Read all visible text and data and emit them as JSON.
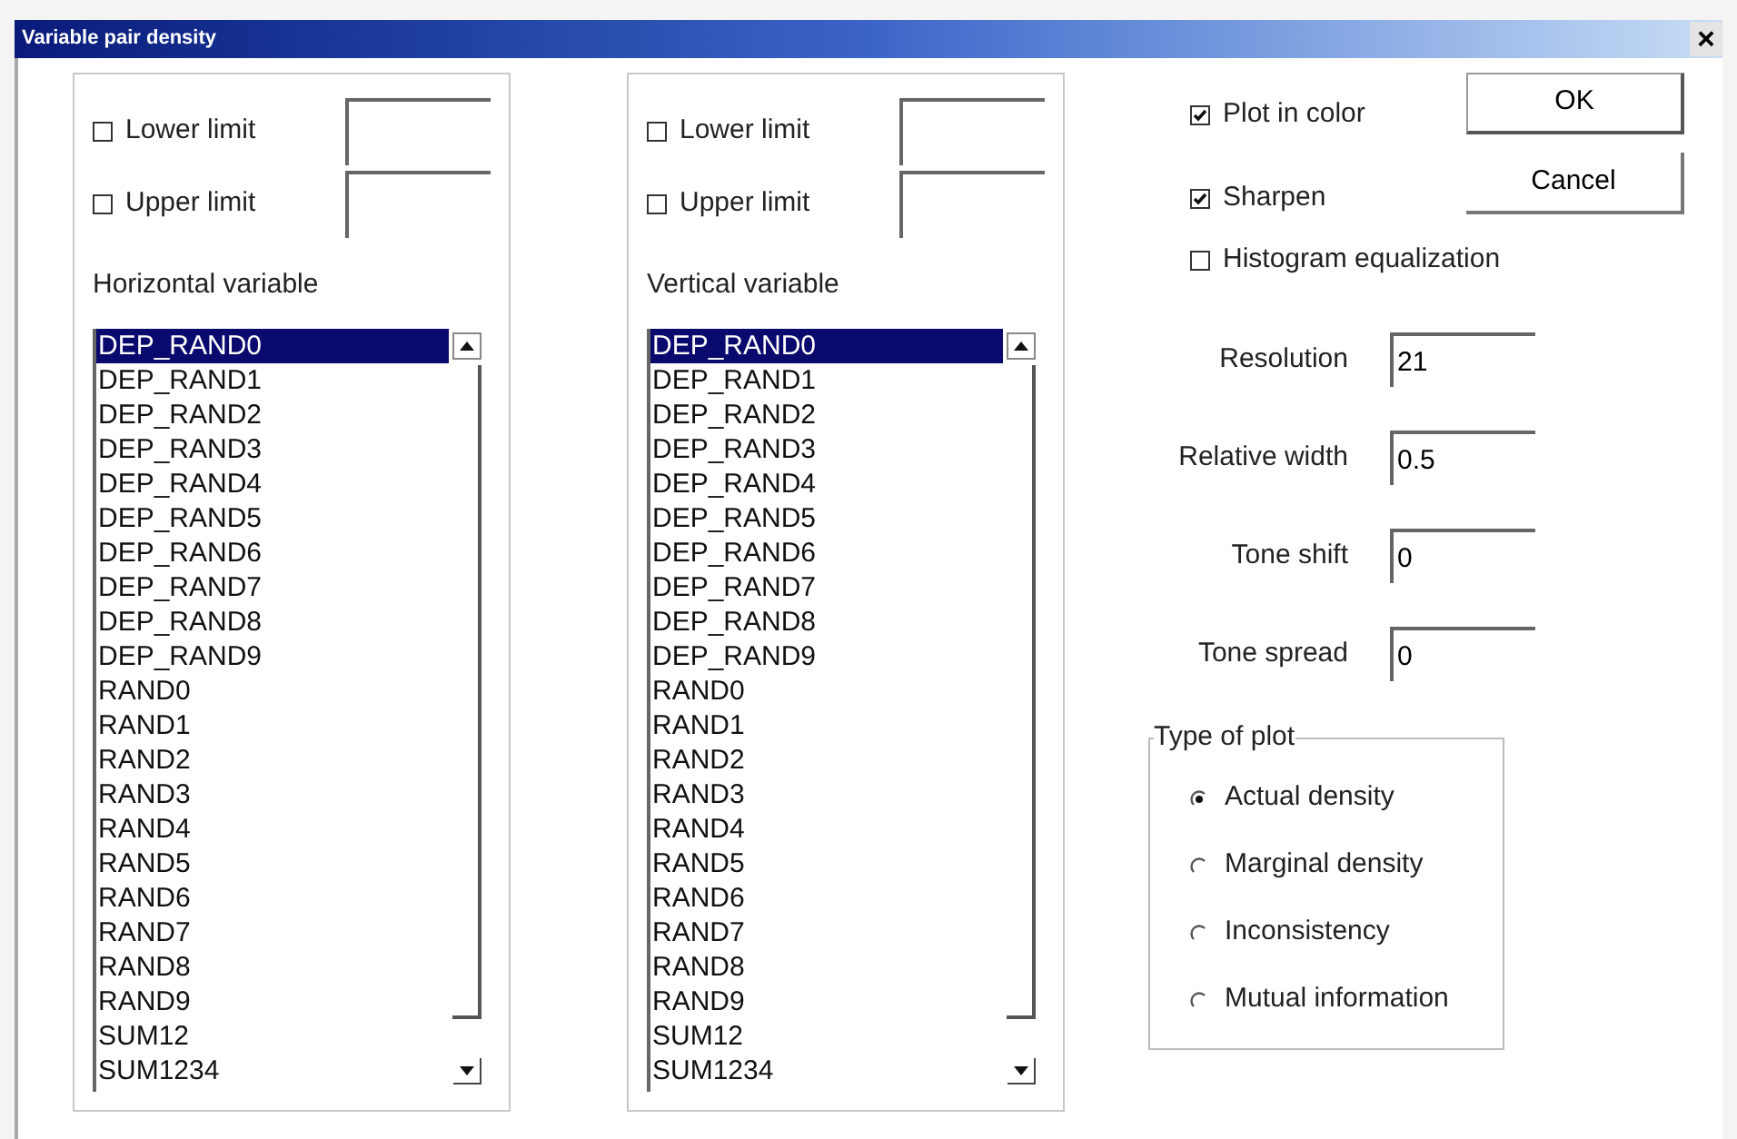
{
  "window": {
    "title": "Variable pair density",
    "close": "×"
  },
  "panels": [
    {
      "limits": [
        {
          "label": "Lower limit",
          "checked": false
        },
        {
          "label": "Upper limit",
          "checked": false
        }
      ],
      "list_label": "Horizontal variable",
      "items": [
        {
          "label": "DEP_RAND0",
          "selected": true
        },
        {
          "label": "DEP_RAND1",
          "selected": false
        },
        {
          "label": "DEP_RAND2",
          "selected": false
        },
        {
          "label": "DEP_RAND3",
          "selected": false
        },
        {
          "label": "DEP_RAND4",
          "selected": false
        },
        {
          "label": "DEP_RAND5",
          "selected": false
        },
        {
          "label": "DEP_RAND6",
          "selected": false
        },
        {
          "label": "DEP_RAND7",
          "selected": false
        },
        {
          "label": "DEP_RAND8",
          "selected": false
        },
        {
          "label": "DEP_RAND9",
          "selected": false
        },
        {
          "label": "RAND0",
          "selected": false
        },
        {
          "label": "RAND1",
          "selected": false
        },
        {
          "label": "RAND2",
          "selected": false
        },
        {
          "label": "RAND3",
          "selected": false
        },
        {
          "label": "RAND4",
          "selected": false
        },
        {
          "label": "RAND5",
          "selected": false
        },
        {
          "label": "RAND6",
          "selected": false
        },
        {
          "label": "RAND7",
          "selected": false
        },
        {
          "label": "RAND8",
          "selected": false
        },
        {
          "label": "RAND9",
          "selected": false
        },
        {
          "label": "SUM12",
          "selected": false
        },
        {
          "label": "SUM1234",
          "selected": false
        }
      ]
    },
    {
      "limits": [
        {
          "label": "Lower limit",
          "checked": false
        },
        {
          "label": "Upper limit",
          "checked": false
        }
      ],
      "list_label": "Vertical variable",
      "items": [
        {
          "label": "DEP_RAND0",
          "selected": true
        },
        {
          "label": "DEP_RAND1",
          "selected": false
        },
        {
          "label": "DEP_RAND2",
          "selected": false
        },
        {
          "label": "DEP_RAND3",
          "selected": false
        },
        {
          "label": "DEP_RAND4",
          "selected": false
        },
        {
          "label": "DEP_RAND5",
          "selected": false
        },
        {
          "label": "DEP_RAND6",
          "selected": false
        },
        {
          "label": "DEP_RAND7",
          "selected": false
        },
        {
          "label": "DEP_RAND8",
          "selected": false
        },
        {
          "label": "DEP_RAND9",
          "selected": false
        },
        {
          "label": "RAND0",
          "selected": false
        },
        {
          "label": "RAND1",
          "selected": false
        },
        {
          "label": "RAND2",
          "selected": false
        },
        {
          "label": "RAND3",
          "selected": false
        },
        {
          "label": "RAND4",
          "selected": false
        },
        {
          "label": "RAND5",
          "selected": false
        },
        {
          "label": "RAND6",
          "selected": false
        },
        {
          "label": "RAND7",
          "selected": false
        },
        {
          "label": "RAND8",
          "selected": false
        },
        {
          "label": "RAND9",
          "selected": false
        },
        {
          "label": "SUM12",
          "selected": false
        },
        {
          "label": "SUM1234",
          "selected": false
        }
      ]
    }
  ],
  "options": [
    {
      "label": "Plot in color",
      "checked": true
    },
    {
      "label": "Sharpen",
      "checked": true
    },
    {
      "label": "Histogram equalization",
      "checked": false
    }
  ],
  "buttons": [
    "OK",
    "Cancel"
  ],
  "parameters": [
    {
      "label": "Resolution",
      "value": "21"
    },
    {
      "label": "Relative width",
      "value": "0.5"
    },
    {
      "label": "Tone shift",
      "value": "0"
    },
    {
      "label": "Tone spread",
      "value": "0"
    }
  ],
  "plot_type": {
    "title": "Type of plot",
    "options": [
      {
        "label": "Actual density",
        "selected": true
      },
      {
        "label": "Marginal density",
        "selected": false
      },
      {
        "label": "Inconsistency",
        "selected": false
      },
      {
        "label": "Mutual information",
        "selected": false
      }
    ]
  }
}
